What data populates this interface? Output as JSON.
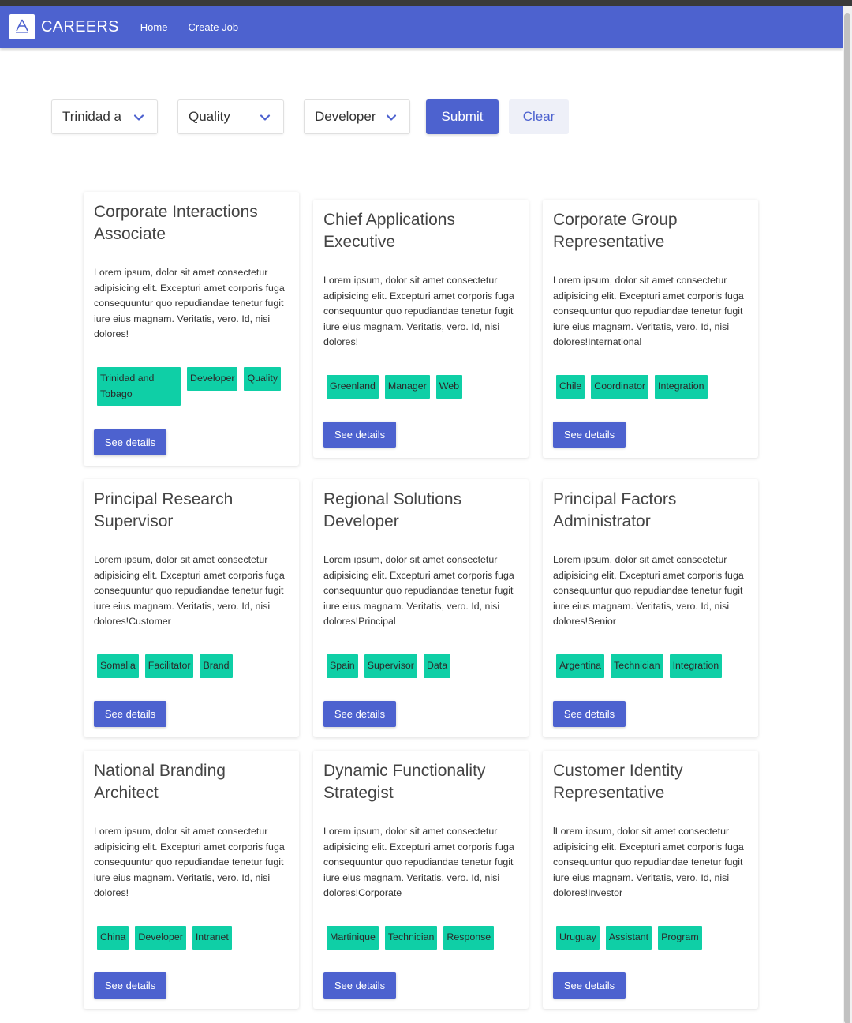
{
  "navbar": {
    "brand": "CAREERS",
    "links": [
      "Home",
      "Create Job"
    ]
  },
  "filters": {
    "location": "Trinidad a",
    "department": "Quality",
    "role": "Developer",
    "submit_label": "Submit",
    "clear_label": "Clear"
  },
  "colors": {
    "primary": "#4d62cf",
    "tag": "#0fcfa6"
  },
  "details_label": "See details",
  "jobs": [
    {
      "title": "Corporate Interactions Associate",
      "description": "Lorem ipsum, dolor sit amet consectetur adipisicing elit. Excepturi amet corporis fuga consequuntur quo repudiandae tenetur fugit iure eius magnam. Veritatis, vero. Id, nisi dolores!",
      "tags": [
        "Trinidad and Tobago",
        "Developer",
        "Quality"
      ]
    },
    {
      "title": "Chief Applications Executive",
      "description": "Lorem ipsum, dolor sit amet consectetur adipisicing elit. Excepturi amet corporis fuga consequuntur quo repudiandae tenetur fugit iure eius magnam. Veritatis, vero. Id, nisi dolores!",
      "tags": [
        "Greenland",
        "Manager",
        "Web"
      ]
    },
    {
      "title": "Corporate Group Representative",
      "description": "Lorem ipsum, dolor sit amet consectetur adipisicing elit. Excepturi amet corporis fuga consequuntur quo repudiandae tenetur fugit iure eius magnam. Veritatis, vero. Id, nisi dolores!International",
      "tags": [
        "Chile",
        "Coordinator",
        "Integration"
      ]
    },
    {
      "title": "Principal Research Supervisor",
      "description": "Lorem ipsum, dolor sit amet consectetur adipisicing elit. Excepturi amet corporis fuga consequuntur quo repudiandae tenetur fugit iure eius magnam. Veritatis, vero. Id, nisi dolores!Customer",
      "tags": [
        "Somalia",
        "Facilitator",
        "Brand"
      ]
    },
    {
      "title": "Regional Solutions Developer",
      "description": "Lorem ipsum, dolor sit amet consectetur adipisicing elit. Excepturi amet corporis fuga consequuntur quo repudiandae tenetur fugit iure eius magnam. Veritatis, vero. Id, nisi dolores!Principal",
      "tags": [
        "Spain",
        "Supervisor",
        "Data"
      ]
    },
    {
      "title": "Principal Factors Administrator",
      "description": "Lorem ipsum, dolor sit amet consectetur adipisicing elit. Excepturi amet corporis fuga consequuntur quo repudiandae tenetur fugit iure eius magnam. Veritatis, vero. Id, nisi dolores!Senior",
      "tags": [
        "Argentina",
        "Technician",
        "Integration"
      ]
    },
    {
      "title": "National Branding Architect",
      "description": "Lorem ipsum, dolor sit amet consectetur adipisicing elit. Excepturi amet corporis fuga consequuntur quo repudiandae tenetur fugit iure eius magnam. Veritatis, vero. Id, nisi dolores!",
      "tags": [
        "China",
        "Developer",
        "Intranet"
      ]
    },
    {
      "title": "Dynamic Functionality Strategist",
      "description": "Lorem ipsum, dolor sit amet consectetur adipisicing elit. Excepturi amet corporis fuga consequuntur quo repudiandae tenetur fugit iure eius magnam. Veritatis, vero. Id, nisi dolores!Corporate",
      "tags": [
        "Martinique",
        "Technician",
        "Response"
      ]
    },
    {
      "title": "Customer Identity Representative",
      "description": "lLorem ipsum, dolor sit amet consectetur adipisicing elit. Excepturi amet corporis fuga consequuntur quo repudiandae tenetur fugit iure eius magnam. Veritatis, vero. Id, nisi dolores!Investor",
      "tags": [
        "Uruguay",
        "Assistant",
        "Program"
      ]
    }
  ]
}
